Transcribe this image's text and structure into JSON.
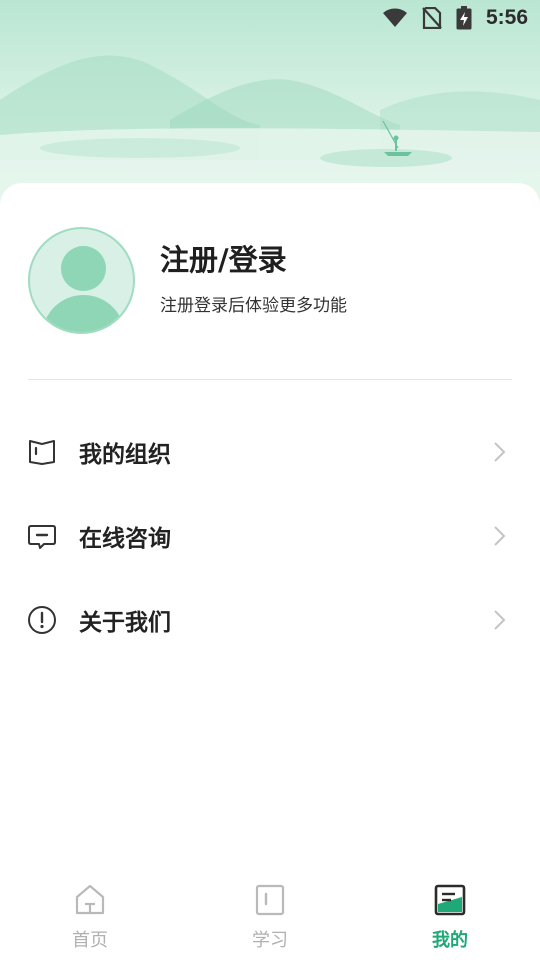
{
  "status_bar": {
    "time": "5:56",
    "icons": [
      "wifi-icon",
      "no-sim-icon",
      "battery-charging-icon"
    ]
  },
  "profile": {
    "title": "注册/登录",
    "subtitle": "注册登录后体验更多功能",
    "avatar_icon": "default-avatar-icon"
  },
  "menu": {
    "items": [
      {
        "label": "我的组织",
        "icon": "organization-icon"
      },
      {
        "label": "在线咨询",
        "icon": "chat-icon"
      },
      {
        "label": "关于我们",
        "icon": "info-icon"
      }
    ]
  },
  "tabbar": {
    "tabs": [
      {
        "label": "首页",
        "icon": "home-icon",
        "active": false
      },
      {
        "label": "学习",
        "icon": "study-icon",
        "active": false
      },
      {
        "label": "我的",
        "icon": "profile-icon",
        "active": true
      }
    ]
  },
  "colors": {
    "accent": "#1fa878",
    "header_green": "#b9e6d2",
    "avatar": "#8ed6b6",
    "inactive_tab": "#b0b0b0"
  }
}
